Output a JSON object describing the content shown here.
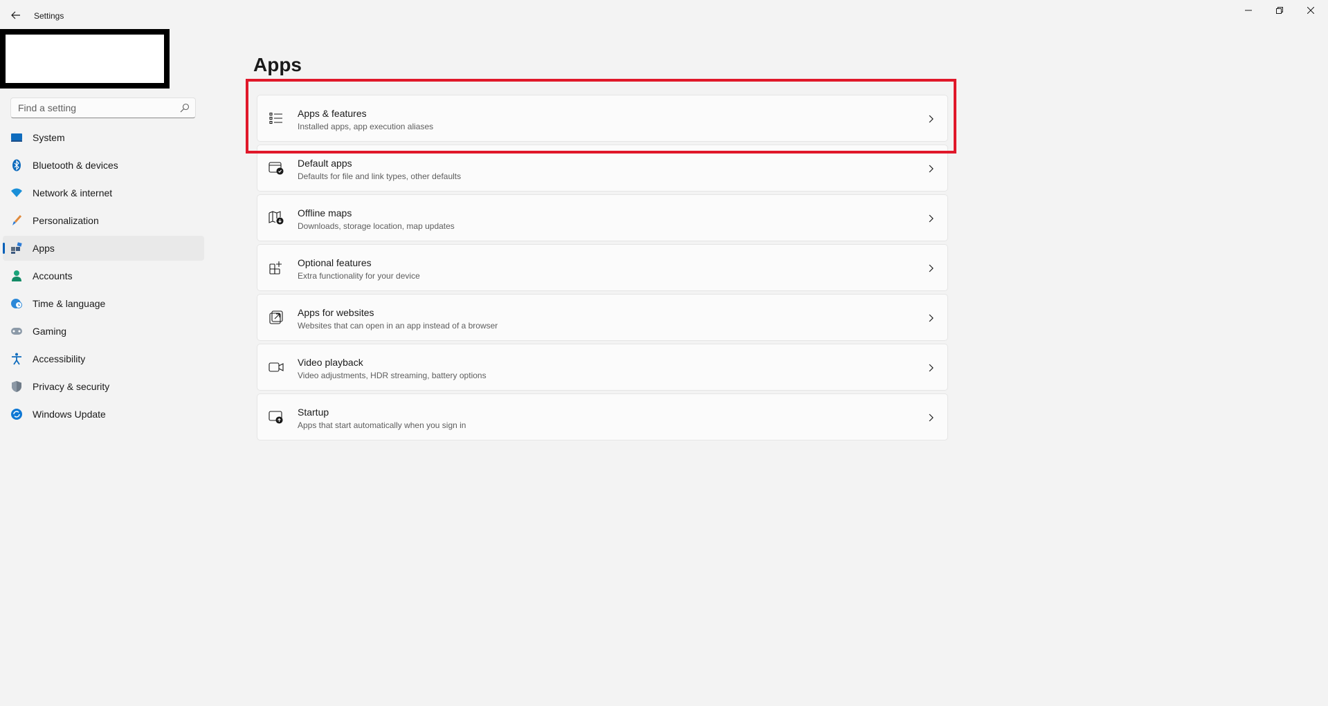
{
  "window": {
    "title": "Settings",
    "controls": [
      "minimize-icon",
      "maximize-icon",
      "close-icon"
    ]
  },
  "search": {
    "placeholder": "Find a setting"
  },
  "sidebar": {
    "items": [
      {
        "label": "System",
        "icon": "system-icon",
        "active": false
      },
      {
        "label": "Bluetooth & devices",
        "icon": "bluetooth-icon",
        "active": false
      },
      {
        "label": "Network & internet",
        "icon": "wifi-icon",
        "active": false
      },
      {
        "label": "Personalization",
        "icon": "brush-icon",
        "active": false
      },
      {
        "label": "Apps",
        "icon": "apps-icon",
        "active": true
      },
      {
        "label": "Accounts",
        "icon": "person-icon",
        "active": false
      },
      {
        "label": "Time & language",
        "icon": "globe-clock-icon",
        "active": false
      },
      {
        "label": "Gaming",
        "icon": "gamepad-icon",
        "active": false
      },
      {
        "label": "Accessibility",
        "icon": "accessibility-icon",
        "active": false
      },
      {
        "label": "Privacy & security",
        "icon": "shield-icon",
        "active": false
      },
      {
        "label": "Windows Update",
        "icon": "update-icon",
        "active": false
      }
    ]
  },
  "main": {
    "title": "Apps",
    "cards": [
      {
        "title": "Apps & features",
        "subtitle": "Installed apps, app execution aliases",
        "icon": "list-icon"
      },
      {
        "title": "Default apps",
        "subtitle": "Defaults for file and link types, other defaults",
        "icon": "default-apps-icon"
      },
      {
        "title": "Offline maps",
        "subtitle": "Downloads, storage location, map updates",
        "icon": "map-download-icon"
      },
      {
        "title": "Optional features",
        "subtitle": "Extra functionality for your device",
        "icon": "add-grid-icon"
      },
      {
        "title": "Apps for websites",
        "subtitle": "Websites that can open in an app instead of a browser",
        "icon": "open-link-icon"
      },
      {
        "title": "Video playback",
        "subtitle": "Video adjustments, HDR streaming, battery options",
        "icon": "video-icon"
      },
      {
        "title": "Startup",
        "subtitle": "Apps that start automatically when you sign in",
        "icon": "startup-icon"
      }
    ]
  },
  "colors": {
    "accent": "#005fb8",
    "highlight": "#e0182a",
    "background": "#f3f3f3"
  }
}
